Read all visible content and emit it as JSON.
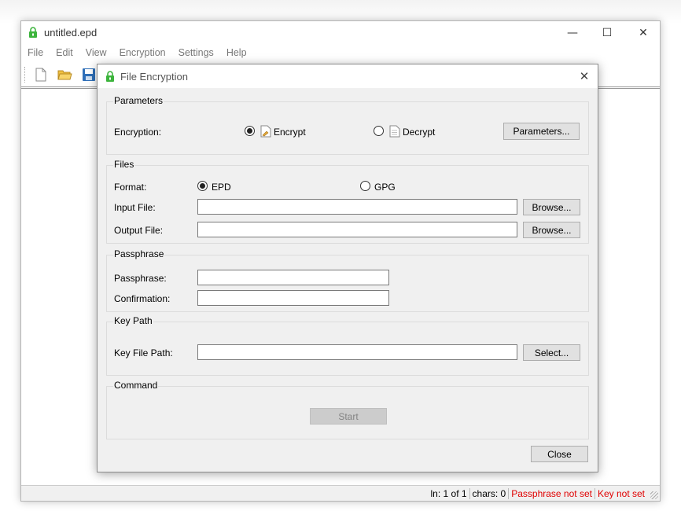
{
  "main_window": {
    "title": "untitled.epd",
    "controls": {
      "minimize": "—",
      "maximize": "☐",
      "close": "✕"
    },
    "menu": [
      "File",
      "Edit",
      "View",
      "Encryption",
      "Settings",
      "Help"
    ],
    "toolbar_icons": [
      "new-file-icon",
      "open-folder-icon",
      "save-icon"
    ],
    "status": {
      "position": "ln: 1 of 1",
      "chars": "chars: 0",
      "passphrase": "Passphrase not set",
      "key": "Key not set"
    }
  },
  "dialog": {
    "title": "File Encryption",
    "close_glyph": "✕",
    "parameters": {
      "title": "Parameters",
      "encryption_label": "Encryption:",
      "encrypt_label": "Encrypt",
      "decrypt_label": "Decrypt",
      "mode": "encrypt",
      "parameters_button": "Parameters..."
    },
    "files": {
      "title": "Files",
      "format_label": "Format:",
      "epd_label": "EPD",
      "gpg_label": "GPG",
      "format": "EPD",
      "input_label": "Input File:",
      "input_value": "",
      "output_label": "Output File:",
      "output_value": "",
      "browse_button": "Browse..."
    },
    "passphrase": {
      "title": "Passphrase",
      "passphrase_label": "Passphrase:",
      "passphrase_value": "",
      "confirmation_label": "Confirmation:",
      "confirmation_value": ""
    },
    "key_path": {
      "title": "Key Path",
      "key_file_label": "Key File Path:",
      "key_file_value": "",
      "select_button": "Select..."
    },
    "command": {
      "title": "Command",
      "start_button": "Start"
    },
    "close_button": "Close"
  },
  "colors": {
    "status_warning": "#e00000",
    "app_icon_green": "#3cb43c"
  }
}
